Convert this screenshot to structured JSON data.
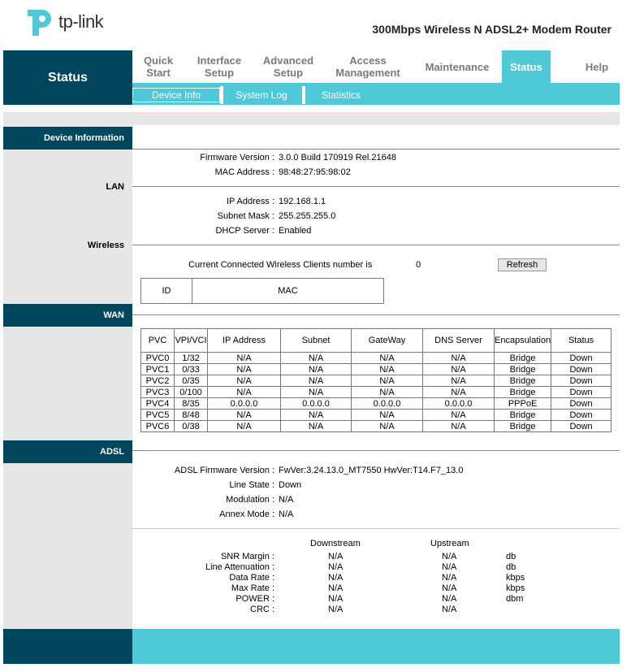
{
  "brand": {
    "logo_text": "tp-link",
    "model": "300Mbps Wireless N ADSL2+ Modem Router",
    "accent": "#4fc8d8",
    "dark": "#00475e"
  },
  "nav": {
    "current_section": "Status",
    "items": [
      {
        "line1": "Quick",
        "line2": "Start"
      },
      {
        "line1": "Interface",
        "line2": "Setup"
      },
      {
        "line1": "Advanced",
        "line2": "Setup"
      },
      {
        "line1": "Access",
        "line2": "Management"
      },
      {
        "line1": "Maintenance",
        "line2": ""
      },
      {
        "line1": "Status",
        "line2": ""
      },
      {
        "line1": "Help",
        "line2": ""
      }
    ],
    "subnav": [
      "Device Info",
      "System Log",
      "Statistics"
    ]
  },
  "device_info": {
    "title": "Device Information",
    "firmware_label": "Firmware Version :",
    "firmware_value": "3.0.0 Build 170919 Rel.21648",
    "mac_label": "MAC Address :",
    "mac_value": "98:48:27:95:98:02"
  },
  "lan": {
    "title": "LAN",
    "ip_label": "IP Address :",
    "ip_value": "192.168.1.1",
    "mask_label": "Subnet Mask :",
    "mask_value": "255.255.255.0",
    "dhcp_label": "DHCP Server :",
    "dhcp_value": "Enabled"
  },
  "wireless": {
    "title": "Wireless",
    "clients_label": "Current Connected Wireless Clients number is",
    "clients_value": "0",
    "refresh_label": "Refresh",
    "col_id": "ID",
    "col_mac": "MAC"
  },
  "wan": {
    "title": "WAN",
    "headers": [
      "PVC",
      "VPI/VCI",
      "IP Address",
      "Subnet",
      "GateWay",
      "DNS Server",
      "Encapsulation",
      "Status"
    ],
    "rows": [
      [
        "PVC0",
        "1/32",
        "N/A",
        "N/A",
        "N/A",
        "N/A",
        "Bridge",
        "Down"
      ],
      [
        "PVC1",
        "0/33",
        "N/A",
        "N/A",
        "N/A",
        "N/A",
        "Bridge",
        "Down"
      ],
      [
        "PVC2",
        "0/35",
        "N/A",
        "N/A",
        "N/A",
        "N/A",
        "Bridge",
        "Down"
      ],
      [
        "PVC3",
        "0/100",
        "N/A",
        "N/A",
        "N/A",
        "N/A",
        "Bridge",
        "Down"
      ],
      [
        "PVC4",
        "8/35",
        "0.0.0.0",
        "0.0.0.0",
        "0.0.0.0",
        "0.0.0.0",
        "PPPoE",
        "Down"
      ],
      [
        "PVC5",
        "8/48",
        "N/A",
        "N/A",
        "N/A",
        "N/A",
        "Bridge",
        "Down"
      ],
      [
        "PVC6",
        "0/38",
        "N/A",
        "N/A",
        "N/A",
        "N/A",
        "Bridge",
        "Down"
      ]
    ]
  },
  "adsl": {
    "title": "ADSL",
    "fw_label": "ADSL Firmware Version :",
    "fw_value": "FwVer:3.24.13.0_MT7550 HwVer:T14.F7_13.0",
    "line_label": "Line State :",
    "line_value": "Down",
    "mod_label": "Modulation :",
    "mod_value": "N/A",
    "annex_label": "Annex Mode :",
    "annex_value": "N/A",
    "col_down": "Downstream",
    "col_up": "Upstream",
    "stats": [
      {
        "label": "SNR Margin :",
        "down": "N/A",
        "up": "N/A",
        "unit": "db"
      },
      {
        "label": "Line Attenuation :",
        "down": "N/A",
        "up": "N/A",
        "unit": "db"
      },
      {
        "label": "Data Rate :",
        "down": "N/A",
        "up": "N/A",
        "unit": "kbps"
      },
      {
        "label": "Max Rate :",
        "down": "N/A",
        "up": "N/A",
        "unit": "kbps"
      },
      {
        "label": "POWER :",
        "down": "N/A",
        "up": "N/A",
        "unit": "dbm"
      },
      {
        "label": "CRC :",
        "down": "N/A",
        "up": "N/A",
        "unit": ""
      }
    ]
  }
}
